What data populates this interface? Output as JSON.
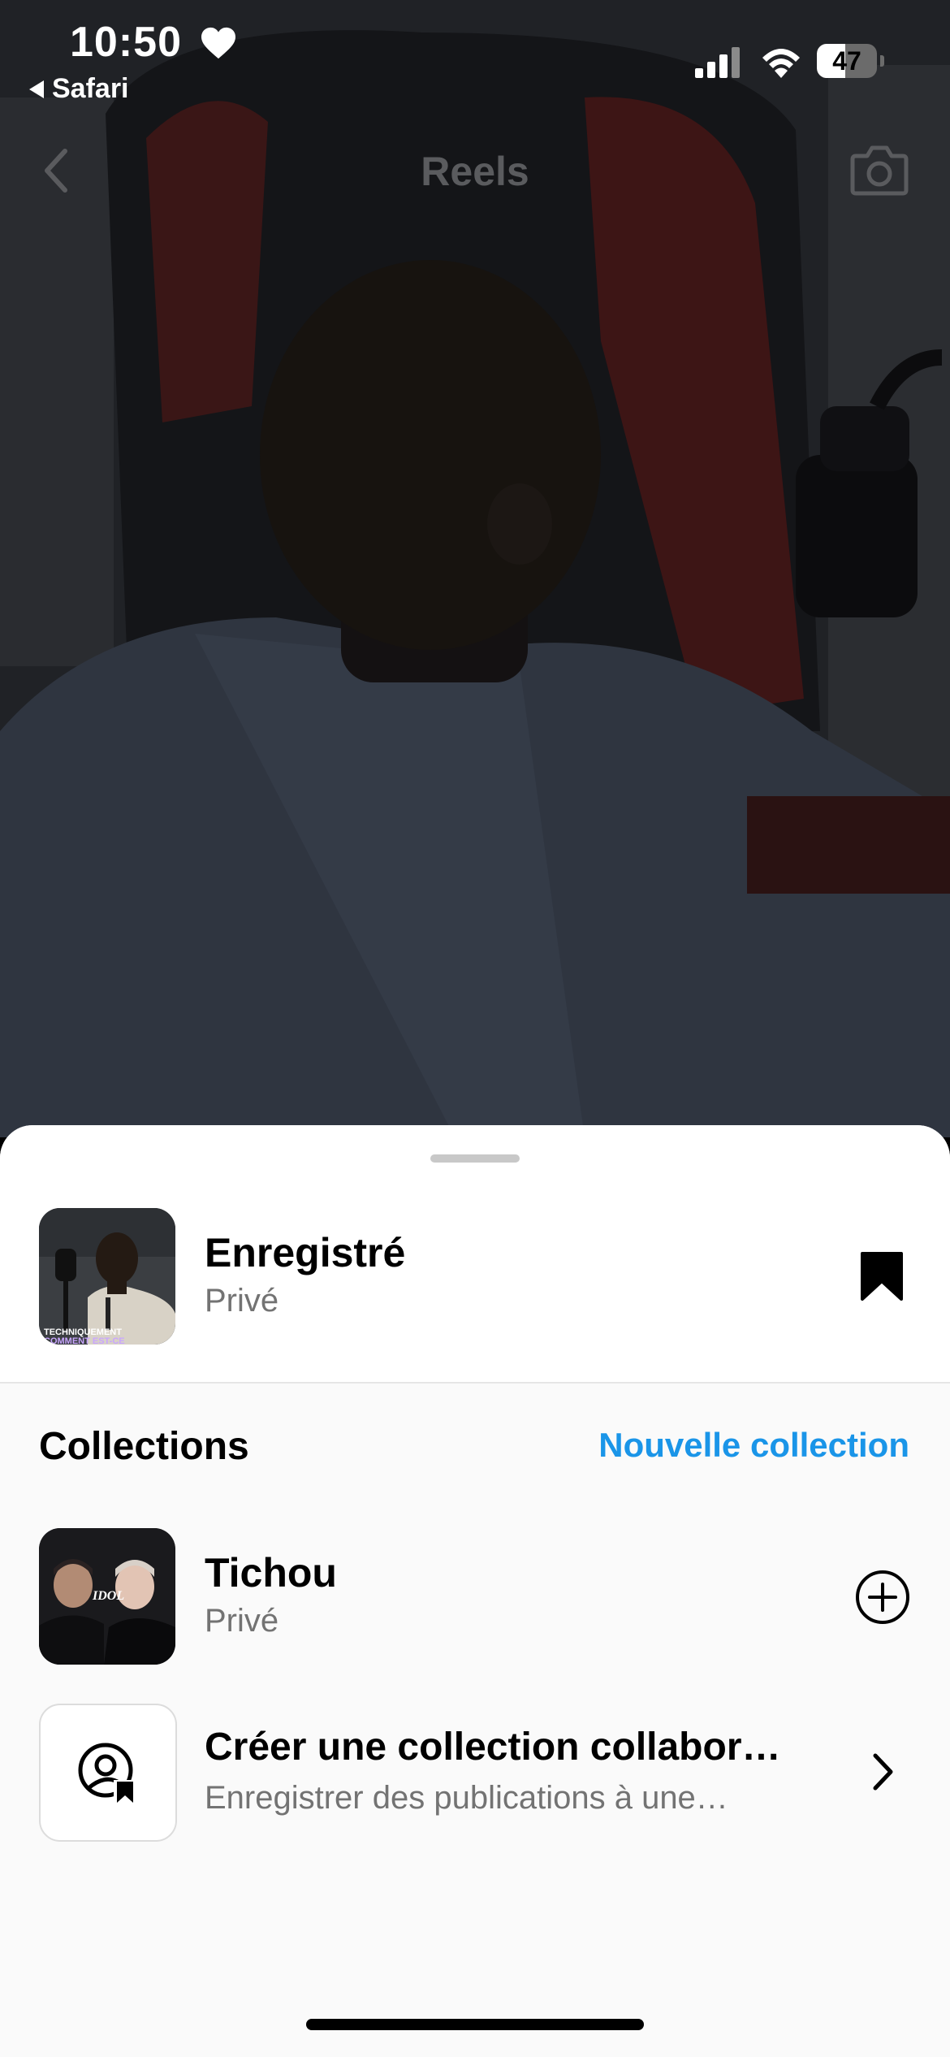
{
  "status_bar": {
    "time": "10:50",
    "back_app": "Safari",
    "battery_level": "47",
    "battery_fraction": 0.47
  },
  "header": {
    "title": "Reels",
    "back_icon": "chevron-left-icon",
    "camera_icon": "camera-icon"
  },
  "sheet": {
    "saved": {
      "title": "Enregistré",
      "subtitle": "Privé",
      "thumb_caption_1": "TECHNIQUEMENT",
      "thumb_caption_2": "COMMENT EST-CE",
      "icon": "bookmark-filled-icon"
    },
    "collections_label": "Collections",
    "new_collection_label": "Nouvelle collection",
    "items": [
      {
        "title": "Tichou",
        "subtitle": "Privé",
        "thumb_text": "IDOL",
        "icon": "add-circle-icon"
      },
      {
        "title": "Créer une collection collabor…",
        "subtitle": "Enregistrer des publications à une…",
        "icon": "chevron-right-icon"
      }
    ]
  },
  "colors": {
    "accent": "#1a95e8",
    "sheet_background": "#fafafa",
    "secondary_text": "#737373"
  }
}
